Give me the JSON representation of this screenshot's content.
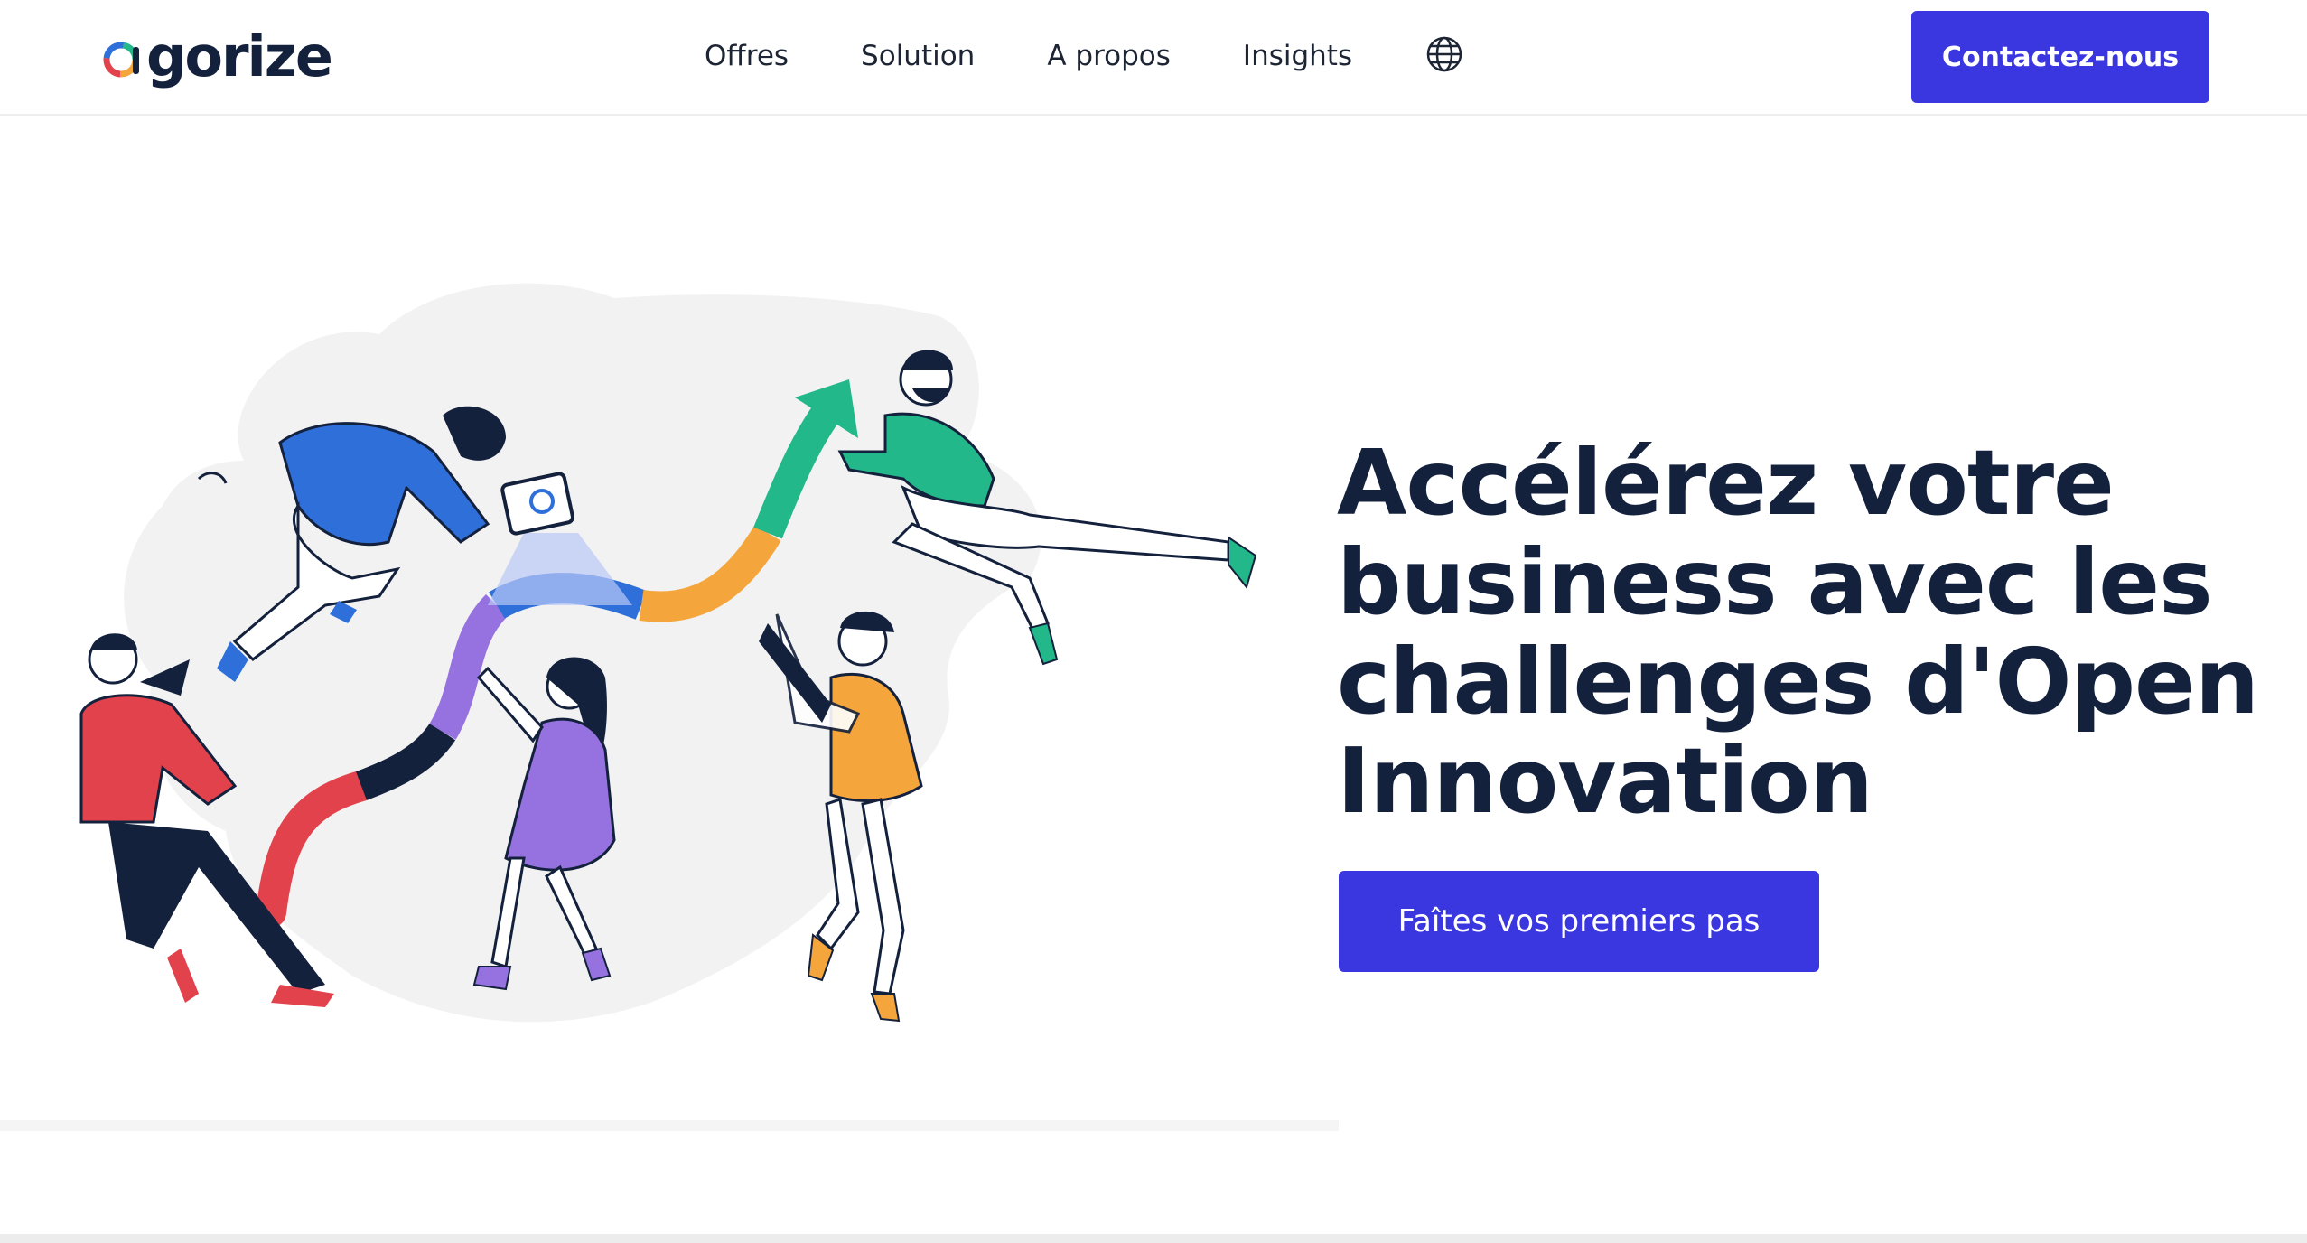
{
  "header": {
    "logo_text": "gorize",
    "nav": [
      {
        "label": "Offres"
      },
      {
        "label": "Solution"
      },
      {
        "label": "A propos"
      },
      {
        "label": "Insights"
      }
    ],
    "language_icon": "globe-icon",
    "contact_label": "Contactez-nous"
  },
  "hero": {
    "title": "Accélérez votre business avec les challenges d'Open Innovation",
    "cta_label": "Faîtes vos premiers pas",
    "illustration": "team-collaboration-illustration"
  },
  "colors": {
    "primary": "#3a36e0",
    "text_dark": "#14213d",
    "red": "#e2424c",
    "blue": "#2f6fd9",
    "green": "#22b889",
    "orange": "#f4a53b",
    "purple": "#9672e0",
    "blob_gray": "#f2f2f2"
  }
}
